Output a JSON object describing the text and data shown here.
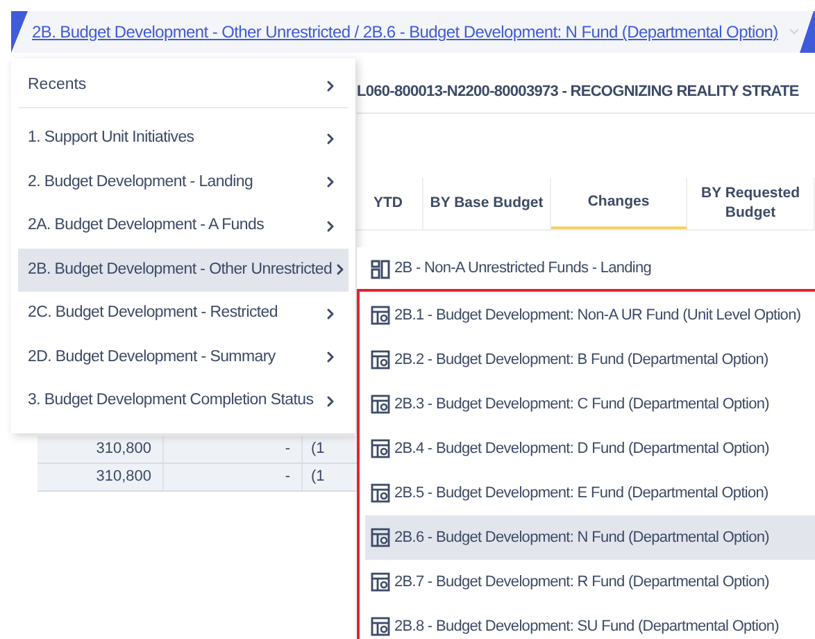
{
  "breadcrumb": {
    "text": "2B. Budget Development - Other Unrestricted / 2B.6 - Budget Development: N Fund (Departmental Option)"
  },
  "page_title": "L060-800013-N2200-80003973 - RECOGNIZING REALITY STRATE",
  "table": {
    "columns": [
      {
        "label": "YTD",
        "active": false
      },
      {
        "label": "BY Base Budget",
        "active": false
      },
      {
        "label": "Changes",
        "active": true
      },
      {
        "label": "BY Requested Budget",
        "active": false
      }
    ],
    "rows": [
      [
        "310,800",
        "-",
        "(1"
      ],
      [
        "310,800",
        "-",
        "(1"
      ]
    ]
  },
  "menu": {
    "recents": "Recents",
    "items": [
      {
        "label": "1. Support Unit Initiatives",
        "selected": false
      },
      {
        "label": "2. Budget Development - Landing",
        "selected": false
      },
      {
        "label": "2A. Budget Development - A Funds",
        "selected": false
      },
      {
        "label": "2B. Budget Development - Other Unrestricted",
        "selected": true
      },
      {
        "label": "2C. Budget Development - Restricted",
        "selected": false
      },
      {
        "label": "2D. Budget Development - Summary",
        "selected": false
      },
      {
        "label": "3. Budget Development Completion Status",
        "selected": false
      }
    ]
  },
  "submenu": {
    "landing": {
      "label": "2B - Non-A Unrestricted Funds - Landing",
      "kind": "landing"
    },
    "outlined": true,
    "items": [
      {
        "label": "2B.1 - Budget Development: Non-A UR Fund (Unit Level Option)",
        "kind": "report",
        "selected": false
      },
      {
        "label": "2B.2 - Budget Development: B Fund (Departmental Option)",
        "kind": "report",
        "selected": false
      },
      {
        "label": "2B.3 - Budget Development: C Fund (Departmental Option)",
        "kind": "report",
        "selected": false
      },
      {
        "label": "2B.4 - Budget Development: D Fund (Departmental Option)",
        "kind": "report",
        "selected": false
      },
      {
        "label": "2B.5 - Budget Development: E Fund (Departmental Option)",
        "kind": "report",
        "selected": false
      },
      {
        "label": "2B.6 - Budget Development: N Fund (Departmental Option)",
        "kind": "report",
        "selected": true
      },
      {
        "label": "2B.7 - Budget Development: R Fund (Departmental Option)",
        "kind": "report",
        "selected": false
      },
      {
        "label": "2B.8 - Budget Development: SU Fund (Departmental Option)",
        "kind": "report",
        "selected": false
      }
    ]
  }
}
